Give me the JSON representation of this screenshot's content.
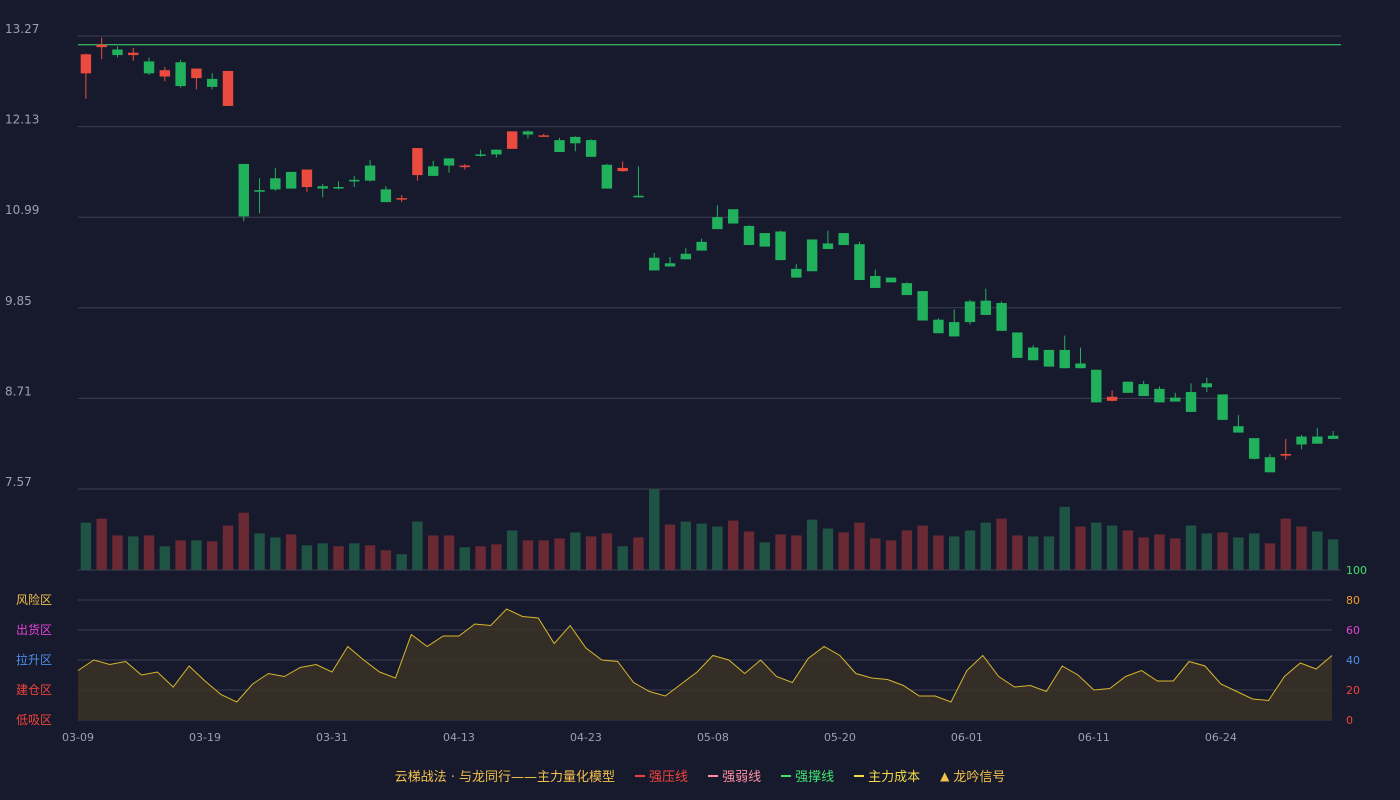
{
  "chart_data": {
    "type": "candlestick",
    "y_ticks": [
      "13.27",
      "12.13",
      "10.99",
      "9.85",
      "8.71",
      "7.57"
    ],
    "ylim": [
      7.57,
      13.27
    ],
    "hline": 13.16,
    "x_ticks": [
      {
        "i": 0,
        "label": "03-09"
      },
      {
        "i": 8,
        "label": "03-19"
      },
      {
        "i": 16,
        "label": "03-31"
      },
      {
        "i": 24,
        "label": "04-13"
      },
      {
        "i": 32,
        "label": "04-23"
      },
      {
        "i": 40,
        "label": "05-08"
      },
      {
        "i": 48,
        "label": "05-20"
      },
      {
        "i": 56,
        "label": "06-01"
      },
      {
        "i": 64,
        "label": "06-11"
      },
      {
        "i": 72,
        "label": "06-24"
      }
    ],
    "ohlc": [
      [
        12.8,
        13.05,
        12.48,
        13.04
      ],
      [
        13.13,
        13.25,
        12.98,
        13.16
      ],
      [
        13.1,
        13.14,
        13.0,
        13.03
      ],
      [
        13.03,
        13.12,
        12.96,
        13.06
      ],
      [
        12.95,
        13.0,
        12.78,
        12.8
      ],
      [
        12.76,
        12.88,
        12.7,
        12.84
      ],
      [
        12.94,
        12.97,
        12.62,
        12.64
      ],
      [
        12.74,
        12.86,
        12.6,
        12.86
      ],
      [
        12.73,
        12.8,
        12.6,
        12.63
      ],
      [
        12.39,
        12.75,
        12.4,
        12.83
      ],
      [
        11.66,
        11.64,
        10.94,
        11.0
      ],
      [
        11.33,
        11.48,
        11.04,
        11.31
      ],
      [
        11.48,
        11.61,
        11.32,
        11.34
      ],
      [
        11.56,
        11.56,
        11.36,
        11.35
      ],
      [
        11.37,
        11.54,
        11.31,
        11.59
      ],
      [
        11.38,
        11.41,
        11.24,
        11.35
      ],
      [
        11.37,
        11.44,
        11.34,
        11.36
      ],
      [
        11.46,
        11.51,
        11.37,
        11.44
      ],
      [
        11.64,
        11.71,
        11.44,
        11.45
      ],
      [
        11.34,
        11.38,
        11.23,
        11.18
      ],
      [
        11.23,
        11.27,
        11.18,
        11.23
      ],
      [
        11.52,
        11.86,
        11.45,
        11.86
      ],
      [
        11.63,
        11.7,
        11.6,
        11.51
      ],
      [
        11.73,
        11.73,
        11.55,
        11.64
      ],
      [
        11.62,
        11.66,
        11.59,
        11.64
      ],
      [
        11.78,
        11.84,
        11.75,
        11.77
      ],
      [
        11.84,
        11.84,
        11.74,
        11.78
      ],
      [
        11.85,
        12.07,
        11.85,
        12.07
      ],
      [
        12.07,
        12.08,
        11.98,
        12.03
      ],
      [
        12.02,
        12.04,
        12.01,
        12.02
      ],
      [
        11.96,
        11.99,
        11.82,
        11.81
      ],
      [
        12.0,
        12.01,
        11.82,
        11.92
      ],
      [
        11.96,
        11.97,
        11.81,
        11.75
      ],
      [
        11.65,
        11.66,
        11.64,
        11.35
      ],
      [
        11.57,
        11.69,
        11.56,
        11.61
      ],
      [
        11.26,
        11.63,
        11.25,
        11.24
      ],
      [
        10.48,
        10.54,
        10.44,
        10.32
      ],
      [
        10.41,
        10.49,
        10.43,
        10.37
      ],
      [
        10.53,
        10.6,
        10.48,
        10.46
      ],
      [
        10.68,
        10.72,
        10.58,
        10.57
      ],
      [
        10.99,
        11.14,
        10.99,
        10.84
      ],
      [
        11.09,
        11.06,
        10.92,
        10.91
      ],
      [
        10.88,
        10.89,
        10.66,
        10.64
      ],
      [
        10.79,
        10.78,
        10.62,
        10.62
      ],
      [
        10.81,
        10.82,
        10.45,
        10.45
      ],
      [
        10.34,
        10.4,
        10.31,
        10.23
      ],
      [
        10.71,
        10.71,
        10.36,
        10.31
      ],
      [
        10.66,
        10.82,
        10.64,
        10.59
      ],
      [
        10.79,
        10.79,
        10.66,
        10.64
      ],
      [
        10.65,
        10.68,
        10.32,
        10.2
      ],
      [
        10.25,
        10.33,
        10.17,
        10.1
      ],
      [
        10.23,
        10.23,
        10.24,
        10.17
      ],
      [
        10.16,
        10.17,
        10.1,
        10.01
      ],
      [
        10.06,
        10.02,
        9.73,
        9.69
      ],
      [
        9.7,
        9.72,
        9.73,
        9.53
      ],
      [
        9.67,
        9.83,
        9.52,
        9.49
      ],
      [
        9.93,
        9.95,
        9.64,
        9.67
      ],
      [
        9.94,
        10.09,
        9.99,
        9.76
      ],
      [
        9.91,
        9.93,
        9.57,
        9.56
      ],
      [
        9.54,
        9.53,
        9.27,
        9.22
      ],
      [
        9.35,
        9.38,
        9.34,
        9.19
      ],
      [
        9.32,
        9.23,
        9.2,
        9.11
      ],
      [
        9.32,
        9.5,
        9.18,
        9.09
      ],
      [
        9.15,
        9.35,
        9.13,
        9.09
      ],
      [
        9.07,
        9.03,
        8.71,
        8.66
      ],
      [
        8.68,
        8.81,
        8.67,
        8.73
      ],
      [
        8.92,
        8.87,
        8.87,
        8.78
      ],
      [
        8.89,
        8.93,
        8.83,
        8.74
      ],
      [
        8.83,
        8.86,
        8.73,
        8.66
      ],
      [
        8.72,
        8.78,
        8.79,
        8.67
      ],
      [
        8.79,
        8.9,
        8.78,
        8.54
      ],
      [
        8.9,
        8.97,
        8.79,
        8.85
      ],
      [
        8.76,
        8.72,
        8.52,
        8.44
      ],
      [
        8.36,
        8.5,
        8.36,
        8.28
      ],
      [
        8.21,
        8.15,
        7.94,
        7.95
      ],
      [
        7.97,
        8.01,
        7.97,
        7.78
      ],
      [
        7.99,
        8.2,
        7.94,
        8.01
      ],
      [
        8.23,
        8.25,
        8.07,
        8.13
      ],
      [
        8.23,
        8.34,
        8.23,
        8.14
      ],
      [
        8.24,
        8.3,
        8.25,
        8.2
      ]
    ],
    "volume": [
      48,
      52,
      35,
      34,
      35,
      24,
      30,
      30,
      29,
      45,
      58,
      37,
      33,
      36,
      25,
      27,
      24,
      27,
      25,
      20,
      16,
      49,
      35,
      35,
      23,
      24,
      26,
      40,
      30,
      30,
      32,
      38,
      34,
      37,
      24,
      33,
      82,
      46,
      49,
      47,
      44,
      50,
      39,
      28,
      36,
      35,
      51,
      42,
      38,
      48,
      32,
      30,
      40,
      45,
      35,
      34,
      40,
      48,
      52,
      35,
      34,
      34,
      64,
      44,
      48,
      45,
      40,
      33,
      36,
      32,
      45,
      37,
      38,
      33,
      37,
      27,
      52,
      44,
      39,
      31
    ],
    "volume_colors": [
      "d",
      "u",
      "u",
      "d",
      "u",
      "d",
      "u",
      "d",
      "u",
      "u",
      "u",
      "d",
      "d",
      "u",
      "d",
      "d",
      "u",
      "d",
      "u",
      "u",
      "d",
      "d",
      "u",
      "u",
      "d",
      "u",
      "u",
      "d",
      "u",
      "u",
      "u",
      "d",
      "u",
      "u",
      "d",
      "u",
      "d",
      "u",
      "d",
      "d",
      "d",
      "u",
      "u",
      "d",
      "u",
      "u",
      "d",
      "d",
      "u",
      "u",
      "u",
      "u",
      "u",
      "u",
      "u",
      "d",
      "d",
      "d",
      "u",
      "u",
      "d",
      "d",
      "d",
      "u",
      "d",
      "d",
      "u",
      "u",
      "u",
      "u",
      "d",
      "d",
      "u",
      "d",
      "d",
      "u",
      "u",
      "u",
      "d",
      "d"
    ],
    "indicator": [
      33,
      40,
      37,
      39,
      30,
      32,
      22,
      36,
      26,
      17,
      12,
      24,
      31,
      29,
      35,
      37,
      32,
      49,
      40,
      32,
      28,
      57,
      49,
      56,
      56,
      64,
      63,
      74,
      69,
      68,
      51,
      63,
      48,
      40,
      39,
      25,
      19,
      16,
      24,
      32,
      43,
      40,
      31,
      40,
      29,
      25,
      41,
      49,
      43,
      31,
      28,
      27,
      23,
      16,
      16,
      12,
      33,
      43,
      29,
      22,
      23,
      19,
      36,
      30,
      20,
      21,
      29,
      33,
      26,
      26,
      39,
      36,
      24,
      19,
      14,
      13,
      29,
      38,
      34,
      43
    ],
    "indicator_range": [
      0,
      100
    ],
    "zone_labels": [
      {
        "v": 80,
        "label": "风险区",
        "color": "#f3c04a"
      },
      {
        "v": 60,
        "label": "出货区",
        "color": "#e243d8"
      },
      {
        "v": 40,
        "label": "拉升区",
        "color": "#4f8fe8"
      },
      {
        "v": 20,
        "label": "建仓区",
        "color": "#f0443a"
      },
      {
        "v": 0,
        "label": "低吸区",
        "color": "#f0443a"
      }
    ],
    "right_ticks": [
      {
        "v": 100,
        "label": "100",
        "color": "#3fe26d"
      },
      {
        "v": 80,
        "label": "80",
        "color": "#f39c2a"
      },
      {
        "v": 60,
        "label": "60",
        "color": "#e243d8"
      },
      {
        "v": 40,
        "label": "40",
        "color": "#4f8fe8"
      },
      {
        "v": 20,
        "label": "20",
        "color": "#f0443a"
      },
      {
        "v": 0,
        "label": "0",
        "color": "#f0443a"
      }
    ]
  },
  "colors": {
    "up": "#eb4b3e",
    "down": "#21b15c",
    "up_volume": "#6b2a33",
    "down_volume": "#1f5445",
    "grid": "#3c3f52",
    "axis_text": "#9aa0b1",
    "hline": "#3fe26d",
    "indicator": "#d8b62a"
  },
  "legend": {
    "title": "云梯战法 · 与龙同行——主力量化模型",
    "title_color": "#f3c04a",
    "items": [
      {
        "label": "强压线",
        "color": "#f0443a",
        "style": "solid"
      },
      {
        "label": "强弱线",
        "color": "#ff8ea0",
        "style": "dashed"
      },
      {
        "label": "强撑线",
        "color": "#3fe26d",
        "style": "solid"
      },
      {
        "label": "主力成本",
        "color": "#f3d94a",
        "style": "dashed"
      },
      {
        "label": "龙吟信号",
        "color": "#f3c04a",
        "style": "triangle"
      }
    ],
    "triangle_glyph": "▲"
  }
}
